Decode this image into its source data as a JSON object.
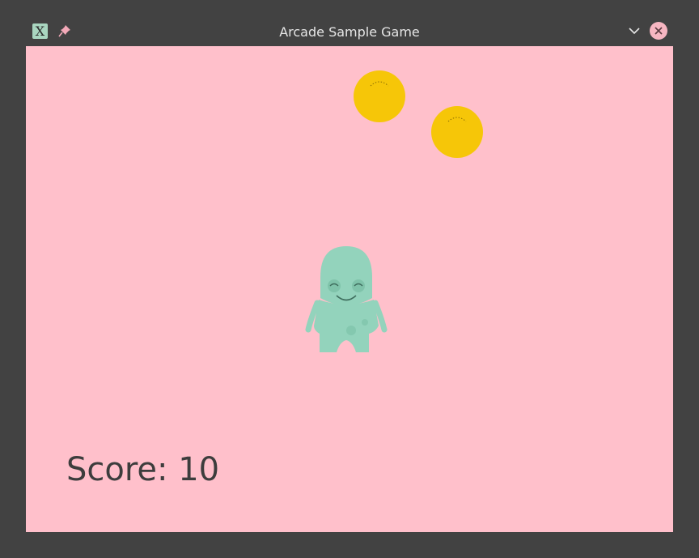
{
  "window": {
    "title": "Arcade Sample Game",
    "app_icon_glyph": "X",
    "icons": [
      "app-icon",
      "pin-icon",
      "minimize-icon",
      "close-icon"
    ]
  },
  "game": {
    "background_color": "#ffc0cb",
    "coin_color": "#f6c608",
    "player_color": "#93d3bc",
    "coins_visible": 2,
    "score_text": "Score: 10"
  }
}
